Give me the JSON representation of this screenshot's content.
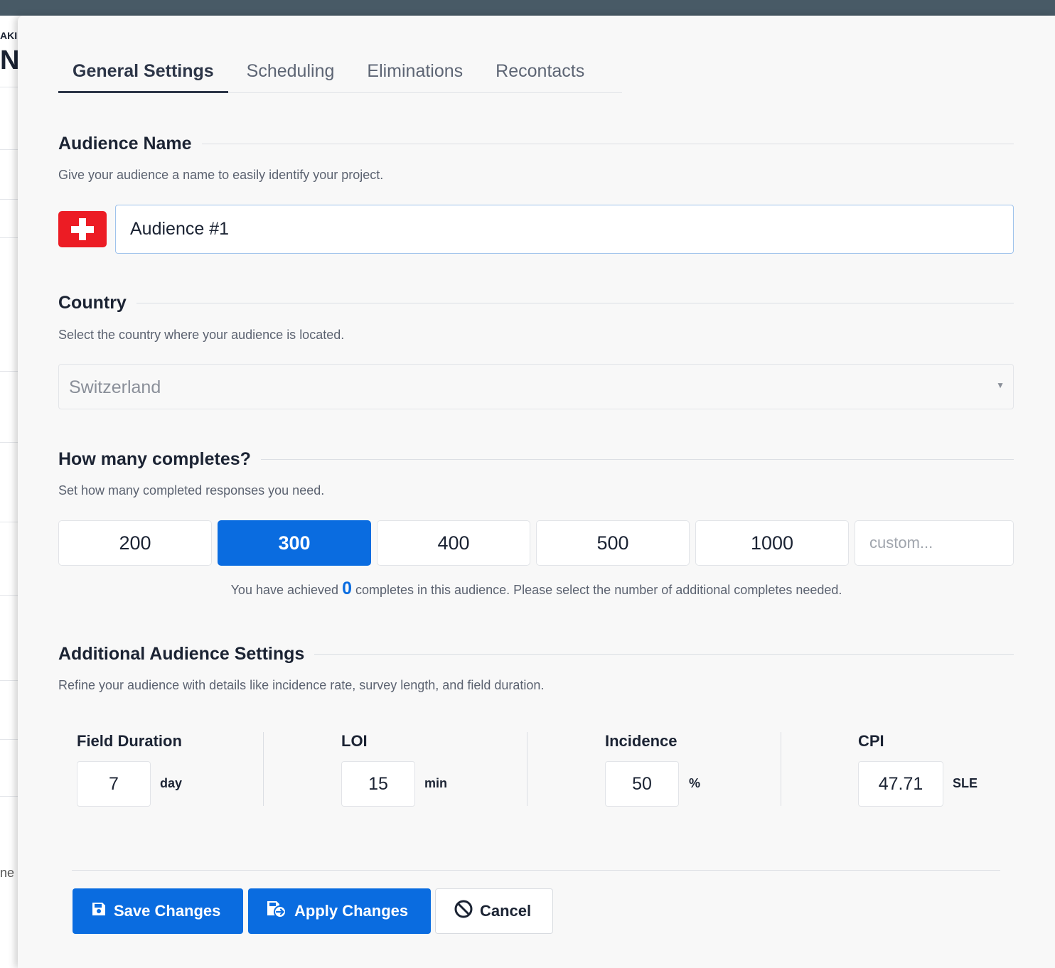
{
  "background": {
    "text_top": "AKI",
    "text_big": "NI",
    "text_bottom": "ne {"
  },
  "tabs": [
    {
      "label": "General Settings",
      "active": true
    },
    {
      "label": "Scheduling",
      "active": false
    },
    {
      "label": "Eliminations",
      "active": false
    },
    {
      "label": "Recontacts",
      "active": false
    }
  ],
  "audience_name": {
    "title": "Audience Name",
    "description": "Give your audience a name to easily identify your project.",
    "value": "Audience #1",
    "flag_icon": "swiss-flag-icon"
  },
  "country": {
    "title": "Country",
    "description": "Select the country where your audience is located.",
    "selected": "Switzerland"
  },
  "completes": {
    "title": "How many completes?",
    "description": "Set how many completed responses you need.",
    "options": [
      "200",
      "300",
      "400",
      "500",
      "1000"
    ],
    "selected": "300",
    "custom_placeholder": "custom...",
    "achieved_prefix": "You have achieved",
    "achieved_count": "0",
    "achieved_suffix": "completes in this audience. Please select the number of additional completes needed."
  },
  "additional": {
    "title": "Additional Audience Settings",
    "description": "Refine your audience with details like incidence rate, survey length, and field duration.",
    "field_duration": {
      "label": "Field Duration",
      "value": "7",
      "unit": "day"
    },
    "loi": {
      "label": "LOI",
      "value": "15",
      "unit": "min"
    },
    "incidence": {
      "label": "Incidence",
      "value": "50",
      "unit": "%"
    },
    "cpi": {
      "label": "CPI",
      "value": "47.71",
      "unit": "SLE"
    }
  },
  "footer": {
    "save_label": "Save Changes",
    "apply_label": "Apply Changes",
    "cancel_label": "Cancel"
  },
  "colors": {
    "primary": "#0a6ce0",
    "flag_red": "#ec1c24",
    "top_bar": "#485a66"
  }
}
